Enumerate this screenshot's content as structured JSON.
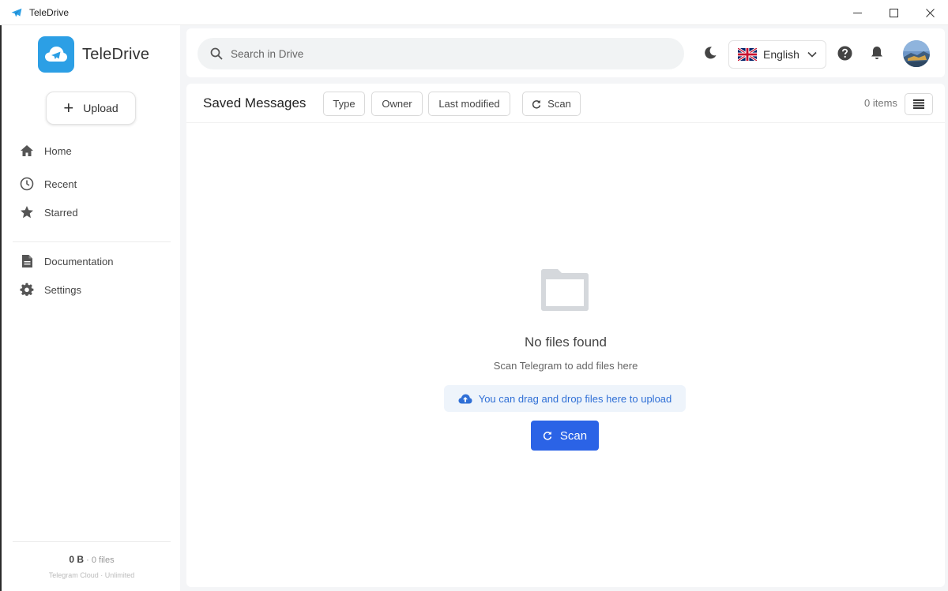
{
  "window": {
    "title": "TeleDrive"
  },
  "sidebar": {
    "logo_text": "TeleDrive",
    "upload_label": "Upload",
    "items": [
      {
        "label": "Home",
        "icon": "home-icon"
      },
      {
        "label": "Recent",
        "icon": "clock-icon"
      },
      {
        "label": "Starred",
        "icon": "star-icon"
      },
      {
        "label": "Documentation",
        "icon": "document-icon"
      },
      {
        "label": "Settings",
        "icon": "gear-icon"
      }
    ],
    "storage": {
      "size": "0 B",
      "separator": "·",
      "files": "0 files",
      "provider": "Telegram Cloud · Unlimited"
    }
  },
  "header": {
    "search_placeholder": "Search in Drive",
    "language": "English"
  },
  "main": {
    "folder_title": "Saved Messages",
    "filters": {
      "type": "Type",
      "owner": "Owner",
      "last_modified": "Last modified",
      "scan": "Scan"
    },
    "items_count": "0 items",
    "empty": {
      "title": "No files found",
      "subtitle": "Scan Telegram to add files here",
      "drag_drop": "You can drag and drop files here to upload",
      "scan_button": "Scan"
    }
  },
  "colors": {
    "accent": "#2b63e6",
    "logo_bg": "#2c9fe5",
    "dnd_bg": "#eef4fb",
    "dnd_text": "#2f6fd6"
  }
}
